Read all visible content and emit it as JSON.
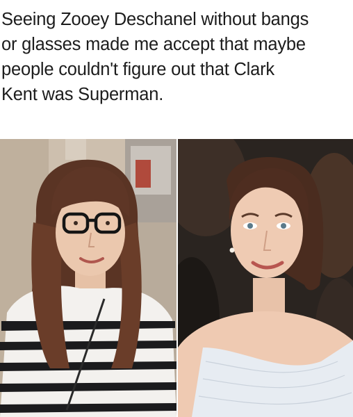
{
  "meme": {
    "caption": "Seeing Zooey Deschanel without bangs\nor glasses made me accept that maybe\npeople couldn't figure out that Clark\nKent was Superman."
  },
  "photos": {
    "left": {
      "subject": "woman with bangs and glasses wearing striped shirt"
    },
    "right": {
      "subject": "woman with hair pulled back in white one-shoulder dress"
    }
  }
}
